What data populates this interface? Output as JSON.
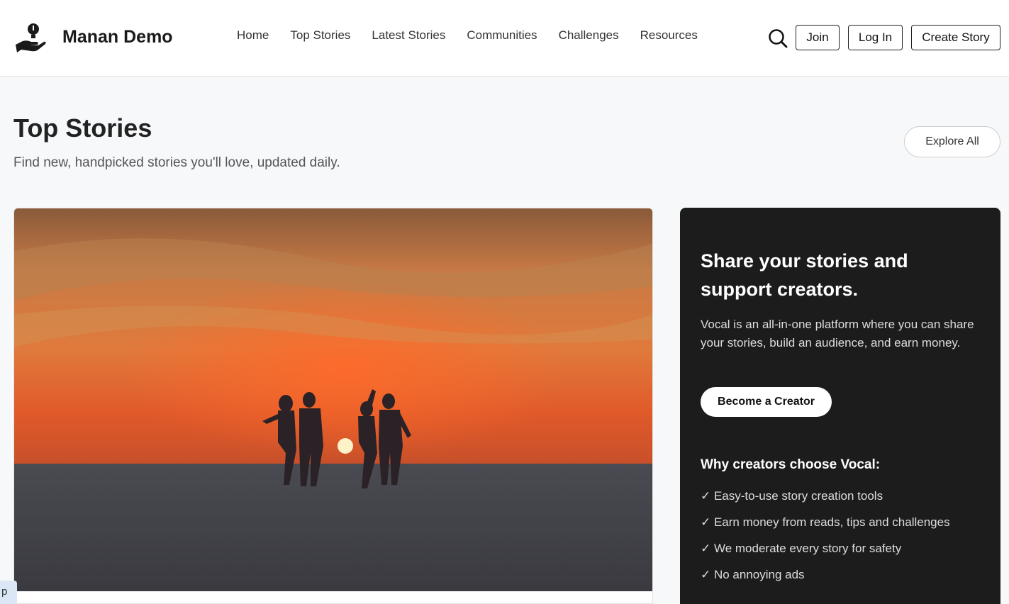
{
  "header": {
    "brand": "Manan Demo",
    "nav": [
      "Home",
      "Top Stories",
      "Latest Stories",
      "Communities",
      "Challenges",
      "Resources"
    ],
    "search_icon": "search-icon",
    "join_label": "Join",
    "login_label": "Log In",
    "create_label": "Create Story"
  },
  "main": {
    "title": "Top Stories",
    "subtitle": "Find new, handpicked stories you'll love, updated daily.",
    "explore_label": "Explore All"
  },
  "panel": {
    "title": "Share your stories and support creators.",
    "text": "Vocal is an all-in-one platform where you can share your stories, build an audience, and earn money.",
    "button": "Become a Creator",
    "why_heading": "Why creators choose Vocal:",
    "checks": [
      "✓ Easy-to-use story creation tools",
      "✓ Earn money from reads, tips and challenges",
      "✓ We moderate every story for safety",
      "✓ No annoying ads"
    ]
  },
  "corner": {
    "label": "p"
  }
}
